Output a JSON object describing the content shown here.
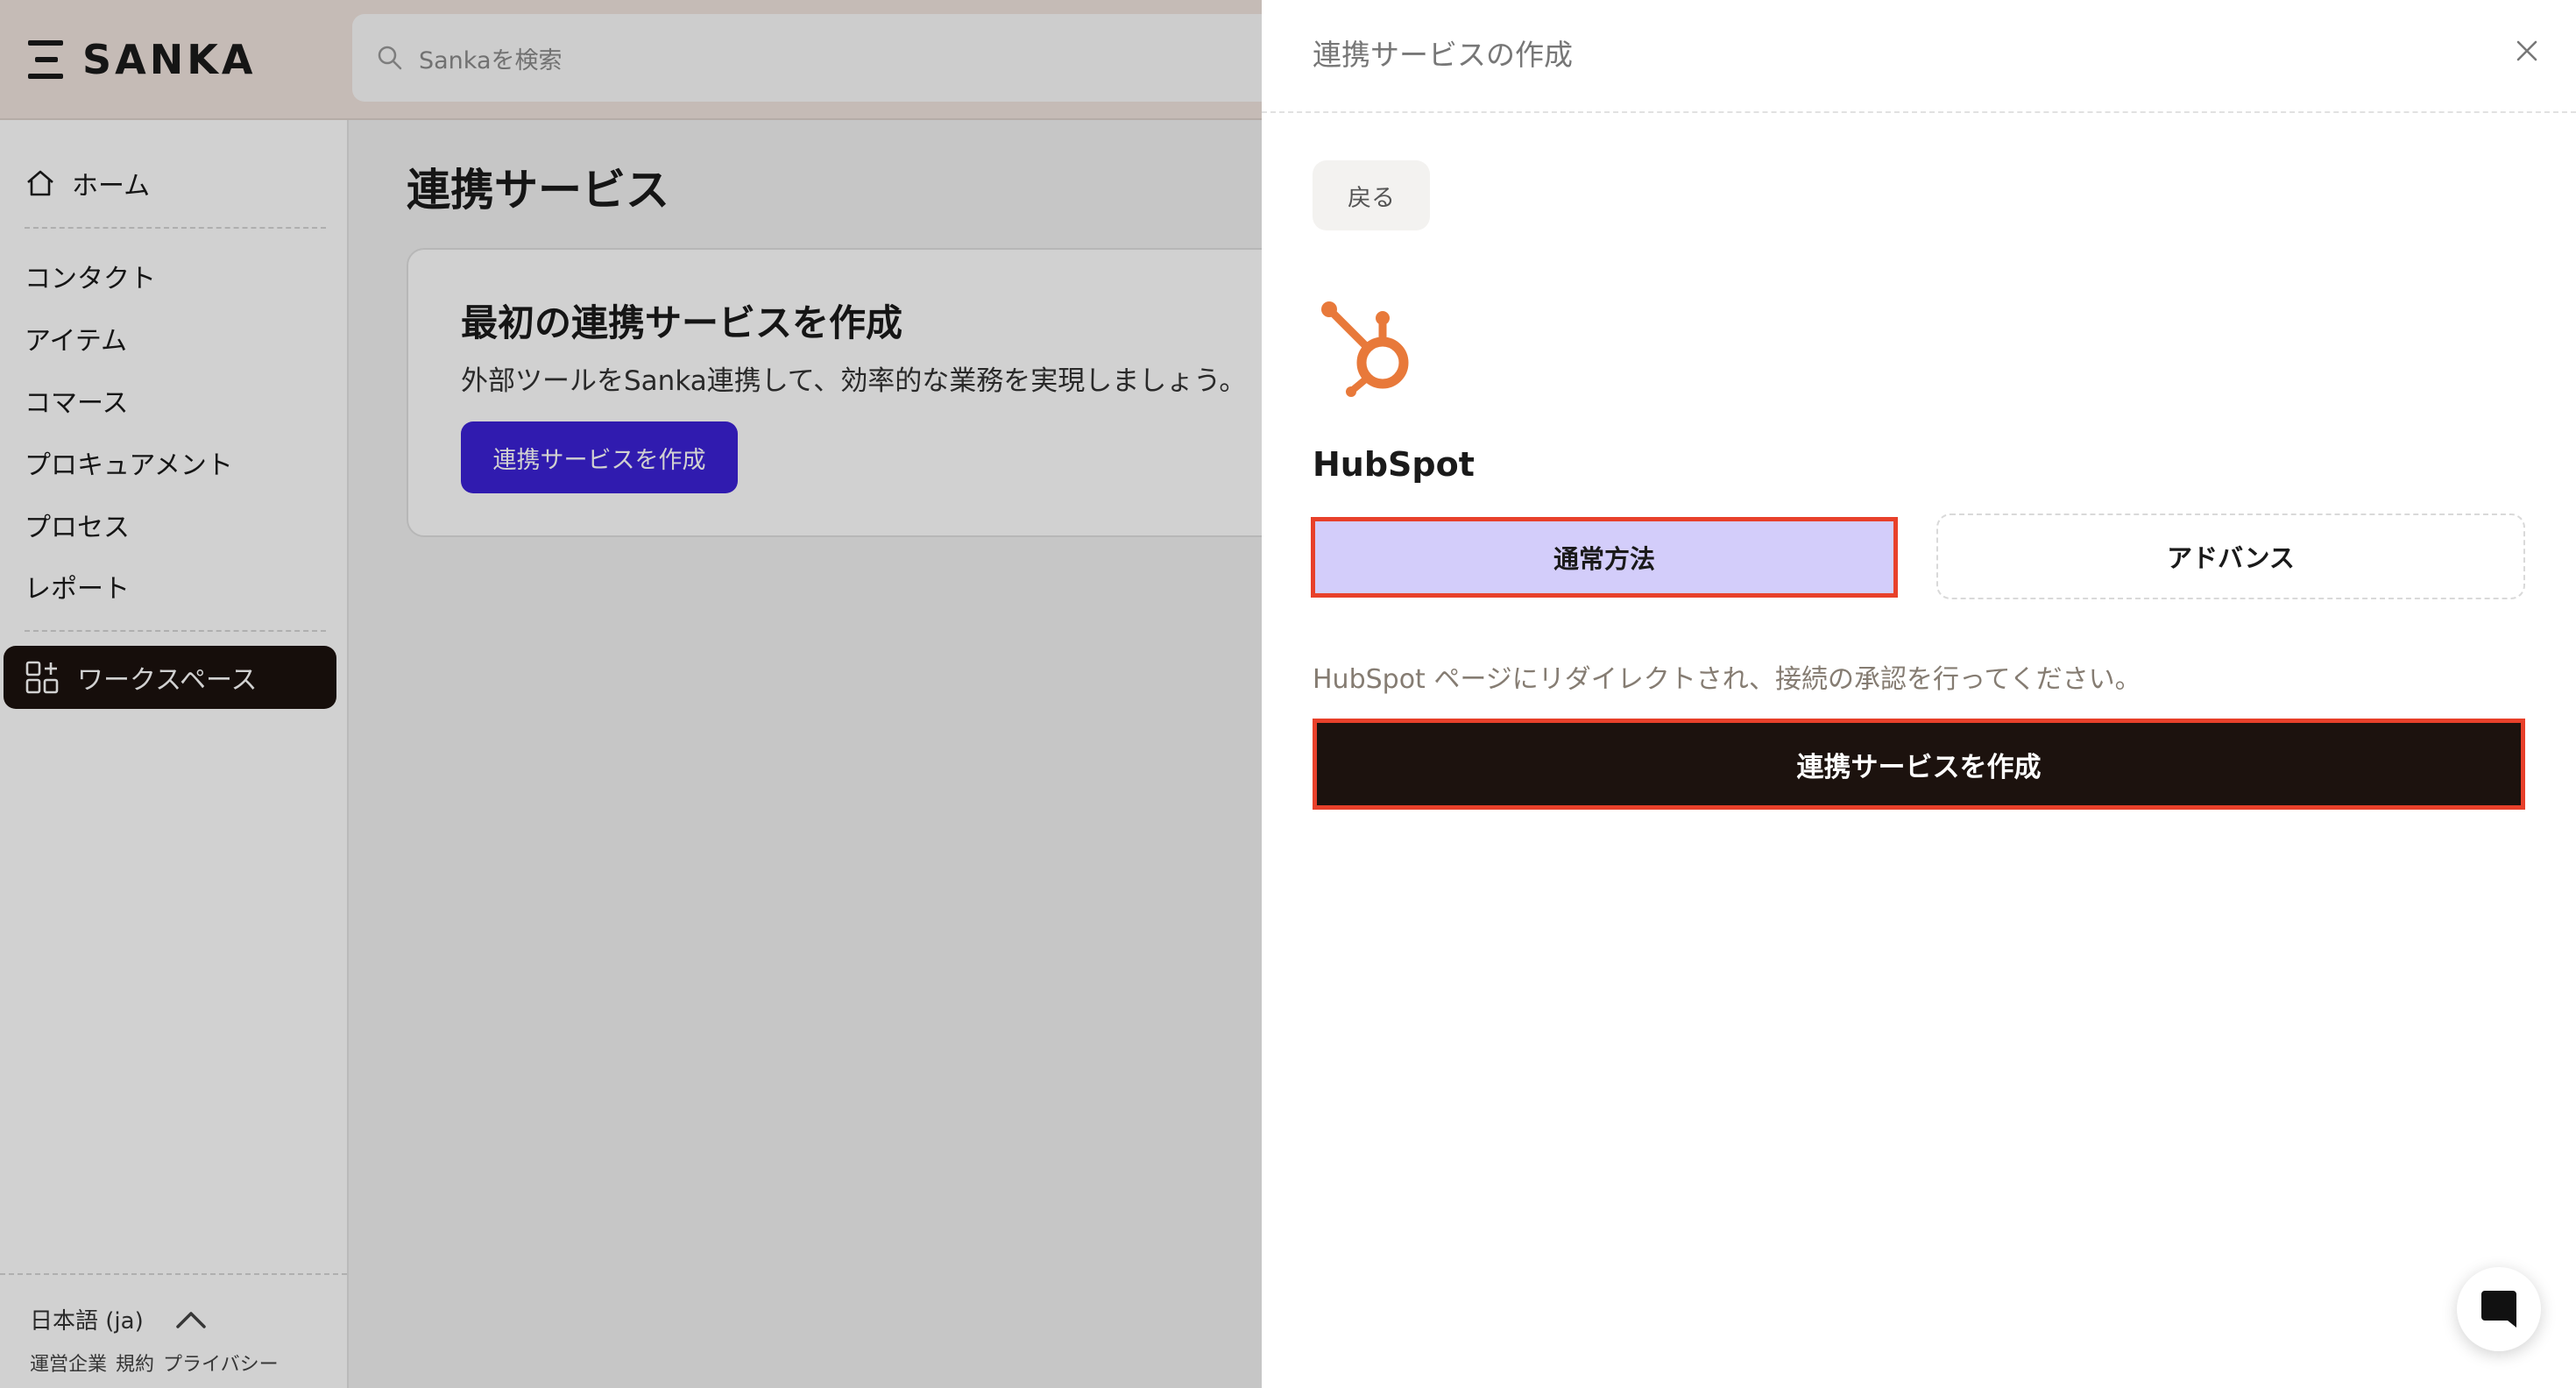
{
  "app": {
    "brand": "SANKA",
    "search_placeholder": "Sankaを検索"
  },
  "sidebar": {
    "home": "ホーム",
    "items": [
      "コンタクト",
      "アイテム",
      "コマース",
      "プロキュアメント",
      "プロセス",
      "レポート"
    ],
    "workspace": "ワークスペース",
    "language": "日本語 (ja)",
    "footer_links": [
      "運営企業",
      "規約",
      "プライバシー"
    ]
  },
  "main": {
    "title": "連携サービス",
    "empty_title": "最初の連携サービスを作成",
    "empty_desc": "外部ツールをSanka連携して、効率的な業務を実現しましょう。",
    "empty_button": "連携サービスを作成"
  },
  "drawer": {
    "title": "連携サービスの作成",
    "back_label": "戻る",
    "service_name": "HubSpot",
    "tab_normal": "通常方法",
    "tab_advanced": "アドバンス",
    "description": "HubSpot ページにリダイレクトされ、接続の承認を行ってください。",
    "create_button": "連携サービスを作成"
  },
  "colors": {
    "accent_purple": "#3b21d6",
    "selected_tab_bg": "#d3cdfa",
    "highlight_border": "#e8402a",
    "dark": "#1c120e",
    "hubspot_orange": "#e8793a"
  },
  "icons": {
    "logo": "sanka-logo-icon",
    "search": "search-icon",
    "home": "home-icon",
    "workspace": "apps-grid-icon",
    "language_toggle": "chevron-up-icon",
    "close": "close-icon",
    "service": "hubspot-logo-icon",
    "chat": "chat-icon"
  }
}
